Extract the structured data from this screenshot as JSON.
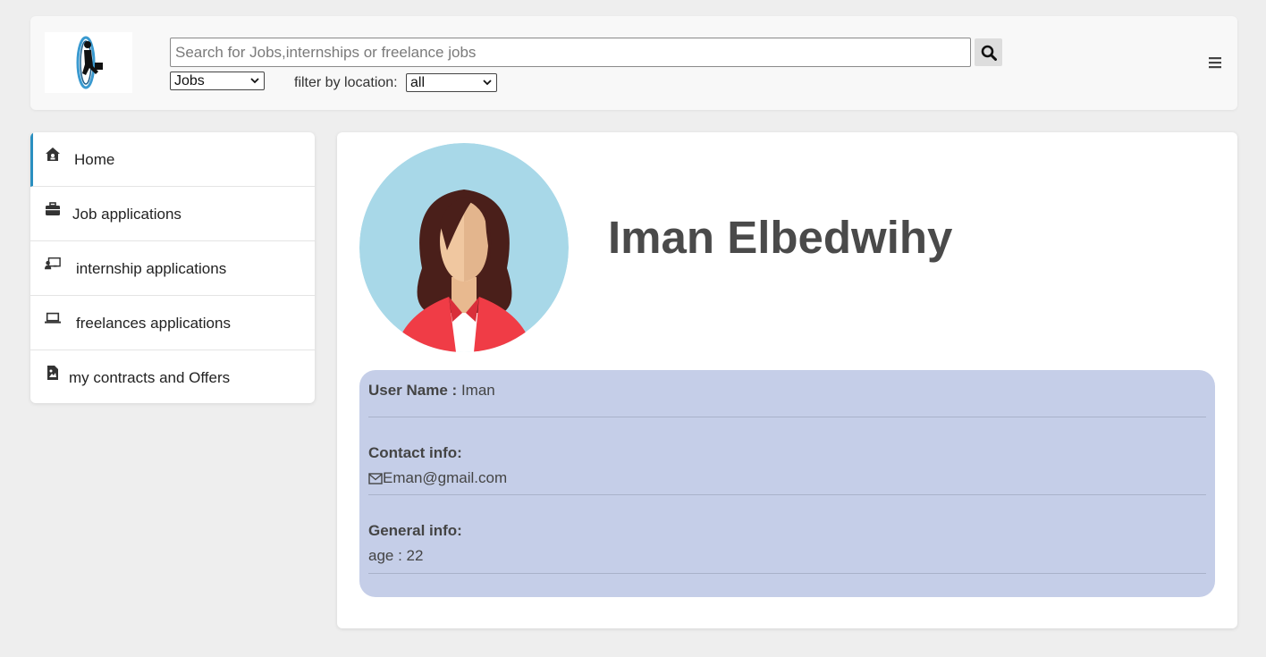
{
  "header": {
    "search": {
      "placeholder": "Search for Jobs,internships or freelance jobs",
      "value": ""
    },
    "type_select": {
      "selected": "Jobs"
    },
    "filter": {
      "label": "filter by location:",
      "selected": "all"
    }
  },
  "sidebar": {
    "items": [
      {
        "label": "Home",
        "icon": "home-icon",
        "active": true
      },
      {
        "label": "Job applications",
        "icon": "briefcase-icon"
      },
      {
        "label": "internship applications",
        "icon": "chalkboard-teacher-icon"
      },
      {
        "label": "freelances applications",
        "icon": "laptop-icon"
      },
      {
        "label": "my contracts and Offers",
        "icon": "file-icon"
      }
    ]
  },
  "profile": {
    "name": "Iman Elbedwihy",
    "username_label": "User Name :",
    "username": "Iman",
    "contact_label": "Contact info:",
    "email": "Eman@gmail.com",
    "general_label": "General info:",
    "age_text": "age : 22"
  },
  "colors": {
    "background": "#eeeeee",
    "info_panel": "#c5cee8",
    "accent": "#2a8fc0",
    "avatar_bg": "#a8d8e8",
    "jacket": "#f03c46"
  }
}
